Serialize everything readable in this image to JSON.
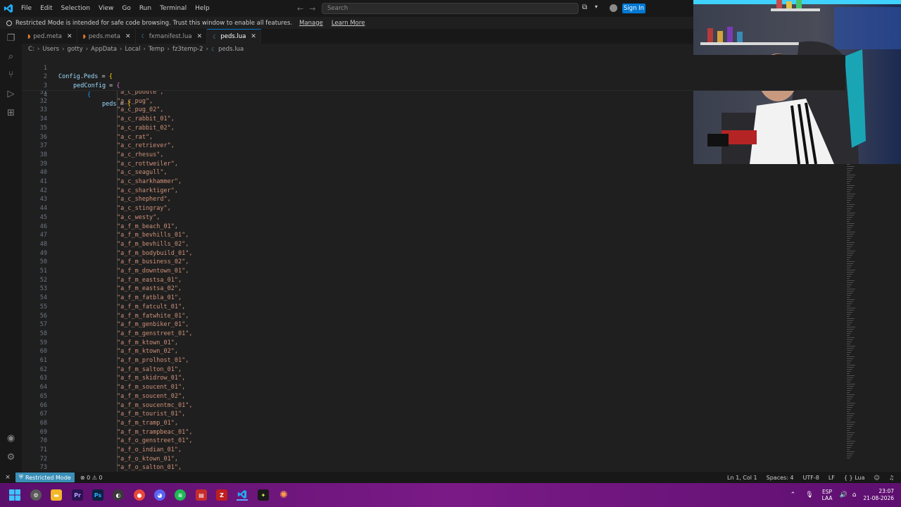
{
  "titlebar": {
    "menu": [
      "File",
      "Edit",
      "Selection",
      "View",
      "Go",
      "Run",
      "Terminal",
      "Help"
    ],
    "search_placeholder": "Search",
    "signin_label": "Sign In"
  },
  "banner": {
    "message": "Restricted Mode is intended for safe code browsing. Trust this window to enable all features.",
    "manage_label": "Manage",
    "learn_more_label": "Learn More"
  },
  "tabs": [
    {
      "label": "ped.meta",
      "icon": "rss-file-icon",
      "active": false
    },
    {
      "label": "peds.meta",
      "icon": "rss-file-icon",
      "active": false
    },
    {
      "label": "fxmanifest.lua",
      "icon": "lua-file-icon",
      "active": false
    },
    {
      "label": "peds.lua",
      "icon": "lua-file-icon",
      "active": true
    }
  ],
  "breadcrumb": [
    "C:",
    "Users",
    "gotty",
    "AppData",
    "Local",
    "Temp",
    "fz3temp-2",
    "peds.lua"
  ],
  "sticky_lines": [
    {
      "n": "1",
      "text": "Config.Peds = {"
    },
    {
      "n": "2",
      "text": "pedConfig = {"
    },
    {
      "n": "3",
      "text": "{"
    },
    {
      "n": "4",
      "text": "peds = {"
    }
  ],
  "code_lines": [
    {
      "n": "31",
      "s": "\"a_c_poodle\","
    },
    {
      "n": "32",
      "s": "\"a_c_pug\","
    },
    {
      "n": "33",
      "s": "\"a_c_pug_02\","
    },
    {
      "n": "34",
      "s": "\"a_c_rabbit_01\","
    },
    {
      "n": "35",
      "s": "\"a_c_rabbit_02\","
    },
    {
      "n": "36",
      "s": "\"a_c_rat\","
    },
    {
      "n": "37",
      "s": "\"a_c_retriever\","
    },
    {
      "n": "38",
      "s": "\"a_c_rhesus\","
    },
    {
      "n": "39",
      "s": "\"a_c_rottweiler\","
    },
    {
      "n": "40",
      "s": "\"a_c_seagull\","
    },
    {
      "n": "41",
      "s": "\"a_c_sharkhammer\","
    },
    {
      "n": "42",
      "s": "\"a_c_sharktiger\","
    },
    {
      "n": "43",
      "s": "\"a_c_shepherd\","
    },
    {
      "n": "44",
      "s": "\"a_c_stingray\","
    },
    {
      "n": "45",
      "s": "\"a_c_westy\","
    },
    {
      "n": "46",
      "s": "\"a_f_m_beach_01\","
    },
    {
      "n": "47",
      "s": "\"a_f_m_bevhills_01\","
    },
    {
      "n": "48",
      "s": "\"a_f_m_bevhills_02\","
    },
    {
      "n": "49",
      "s": "\"a_f_m_bodybuild_01\","
    },
    {
      "n": "50",
      "s": "\"a_f_m_business_02\","
    },
    {
      "n": "51",
      "s": "\"a_f_m_downtown_01\","
    },
    {
      "n": "52",
      "s": "\"a_f_m_eastsa_01\","
    },
    {
      "n": "53",
      "s": "\"a_f_m_eastsa_02\","
    },
    {
      "n": "54",
      "s": "\"a_f_m_fatbla_01\","
    },
    {
      "n": "55",
      "s": "\"a_f_m_fatcult_01\","
    },
    {
      "n": "56",
      "s": "\"a_f_m_fatwhite_01\","
    },
    {
      "n": "57",
      "s": "\"a_f_m_genbiker_01\","
    },
    {
      "n": "58",
      "s": "\"a_f_m_genstreet_01\","
    },
    {
      "n": "59",
      "s": "\"a_f_m_ktown_01\","
    },
    {
      "n": "60",
      "s": "\"a_f_m_ktown_02\","
    },
    {
      "n": "61",
      "s": "\"a_f_m_prolhost_01\","
    },
    {
      "n": "62",
      "s": "\"a_f_m_salton_01\","
    },
    {
      "n": "63",
      "s": "\"a_f_m_skidrow_01\","
    },
    {
      "n": "64",
      "s": "\"a_f_m_soucent_01\","
    },
    {
      "n": "65",
      "s": "\"a_f_m_soucent_02\","
    },
    {
      "n": "66",
      "s": "\"a_f_m_soucentmc_01\","
    },
    {
      "n": "67",
      "s": "\"a_f_m_tourist_01\","
    },
    {
      "n": "68",
      "s": "\"a_f_m_tramp_01\","
    },
    {
      "n": "69",
      "s": "\"a_f_m_trampbeac_01\","
    },
    {
      "n": "70",
      "s": "\"a_f_o_genstreet_01\","
    },
    {
      "n": "71",
      "s": "\"a_f_o_indian_01\","
    },
    {
      "n": "72",
      "s": "\"a_f_o_ktown_01\","
    },
    {
      "n": "73",
      "s": "\"a_f_o_salton_01\","
    }
  ],
  "statusbar": {
    "restricted_label": "Restricted Mode",
    "errors": "0",
    "warnings": "0",
    "cursor_pos": "Ln 1, Col 1",
    "spaces": "Spaces: 4",
    "encoding": "UTF-8",
    "eol": "LF",
    "language": "Lua"
  },
  "taskbar": {
    "lang_line1": "ESP",
    "lang_line2": "LAA",
    "time": "23:07",
    "date": "21-08-2026"
  },
  "colors": {
    "accent": "#0078d4",
    "restricted_badge": "#3a8fb7",
    "string": "#ce9178"
  }
}
